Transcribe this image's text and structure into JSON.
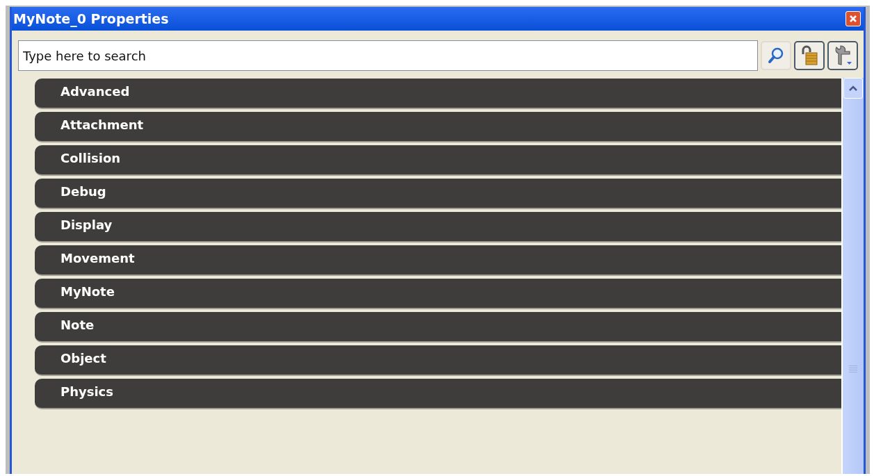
{
  "window": {
    "title": "MyNote_0 Properties"
  },
  "search": {
    "placeholder": "Type here to search"
  },
  "categories": [
    {
      "label": "Advanced"
    },
    {
      "label": "Attachment"
    },
    {
      "label": "Collision"
    },
    {
      "label": "Debug"
    },
    {
      "label": "Display"
    },
    {
      "label": "Movement"
    },
    {
      "label": "MyNote"
    },
    {
      "label": "Note"
    },
    {
      "label": "Object"
    },
    {
      "label": "Physics"
    }
  ]
}
